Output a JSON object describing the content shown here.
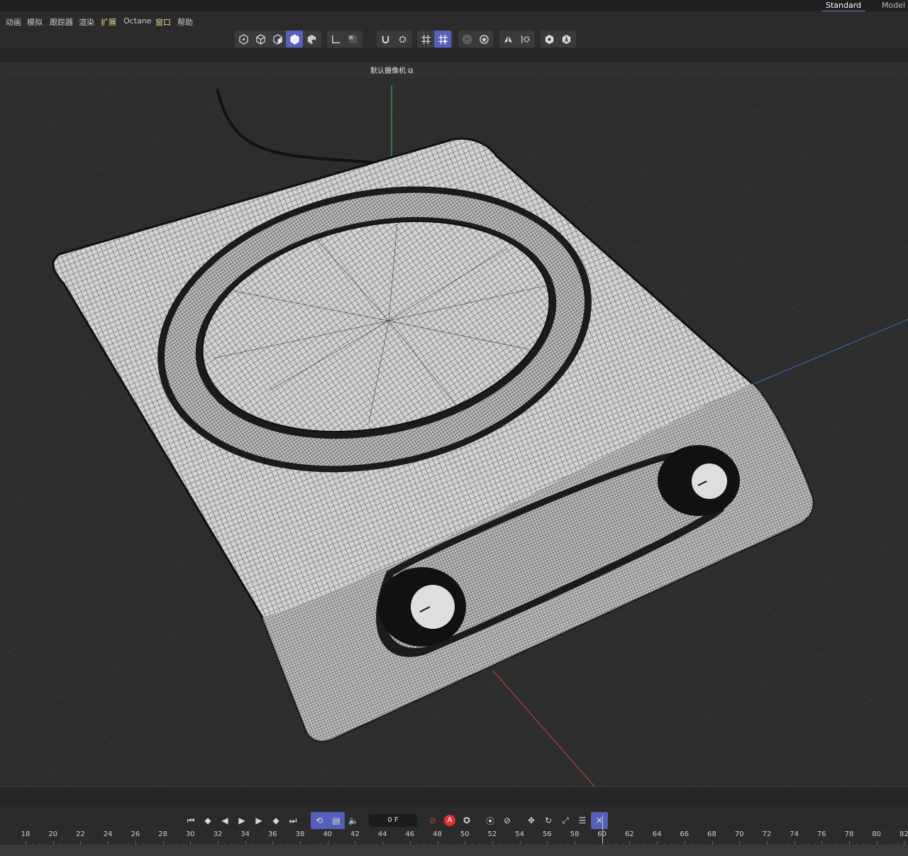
{
  "layout_tabs": {
    "standard": "Standard",
    "model": "Model"
  },
  "menu": [
    "动画",
    "模拟",
    "跟踪器",
    "渲染",
    "扩展",
    "Octane",
    "窗口",
    "帮助"
  ],
  "viewport": {
    "camera_label": "默认摄像机",
    "camera_icon": "camera-switch-icon"
  },
  "timeline": {
    "current_frame": "0 F"
  },
  "ruler_labels": [
    "18",
    "20",
    "22",
    "24",
    "26",
    "28",
    "30",
    "32",
    "34",
    "36",
    "38",
    "40",
    "42",
    "44",
    "46",
    "48",
    "50",
    "52",
    "54",
    "56",
    "58",
    "60",
    "62",
    "64",
    "66",
    "68",
    "70",
    "72",
    "74",
    "76",
    "78",
    "80",
    "82"
  ],
  "colors": {
    "accent": "#5660b8",
    "background": "#2d2d2d",
    "highlight_menu": "#e7d28a",
    "axis_y": "#3bbf5a",
    "axis_x": "#d04545",
    "axis_z": "#3a6fd0"
  }
}
